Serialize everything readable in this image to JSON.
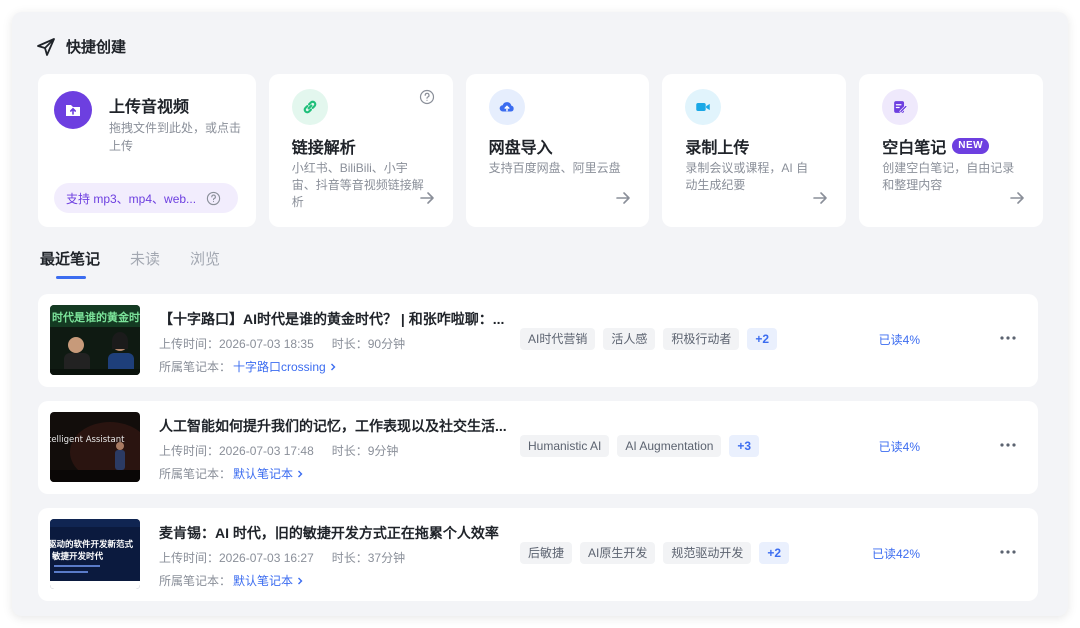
{
  "quick_create": {
    "title": "快捷创建",
    "upload": {
      "title": "上传音视频",
      "desc": "拖拽文件到此处，或点击上传",
      "formats": "支持 mp3、mp4、web..."
    },
    "cards": [
      {
        "title": "链接解析",
        "desc": "小红书、BiliBili、小宇宙、抖音等音视频链接解析",
        "icon": "link-icon",
        "color": "#1fbf7a",
        "bg": "#e3f7ee"
      },
      {
        "title": "网盘导入",
        "desc": "支持百度网盘、阿里云盘",
        "icon": "cloud-upload-icon",
        "color": "#3b6cf0",
        "bg": "#e6eefd"
      },
      {
        "title": "录制上传",
        "desc": "录制会议或课程，AI 自动生成纪要",
        "icon": "video-camera-icon",
        "color": "#1aa8e6",
        "bg": "#e1f4fc"
      },
      {
        "title": "空白笔记",
        "desc": "创建空白笔记，自由记录和整理内容",
        "icon": "edit-note-icon",
        "color": "#6d3fe0",
        "bg": "#efe9fc",
        "badge": "NEW"
      }
    ]
  },
  "tabs": [
    {
      "label": "最近笔记",
      "active": true
    },
    {
      "label": "未读",
      "active": false
    },
    {
      "label": "浏览",
      "active": false
    }
  ],
  "notes": [
    {
      "title": "【十字路口】AI时代是谁的黄金时代？ | 和张咋啦聊：...",
      "uploaded": "上传时间：2026-07-03 18:35",
      "duration": "时长：90分钟",
      "book_label": "所属笔记本：",
      "book": "十字路口crossing",
      "tags": [
        "AI时代营销",
        "活人感",
        "积极行动者"
      ],
      "more": "+2",
      "read": "已读4%"
    },
    {
      "title": "人工智能如何提升我们的记忆，工作表现以及社交生活...",
      "uploaded": "上传时间：2026-07-03 17:48",
      "duration": "时长：9分钟",
      "book_label": "所属笔记本：",
      "book": "默认笔记本",
      "tags": [
        "Humanistic AI",
        "AI Augmentation"
      ],
      "more": "+3",
      "read": "已读4%"
    },
    {
      "title": "麦肯锡：AI 时代，旧的敏捷开发方式正在拖累个人效率",
      "uploaded": "上传时间：2026-07-03 16:27",
      "duration": "时长：37分钟",
      "book_label": "所属笔记本：",
      "book": "默认笔记本",
      "tags": [
        "后敏捷",
        "AI原生开发",
        "规范驱动开发"
      ],
      "more": "+2",
      "read": "已读42%"
    }
  ],
  "thumbs": [
    {
      "text": "时代是谁的黄金时代"
    },
    {
      "text": "telligent Assistant"
    },
    {
      "text": "驱动的软件开发新范式",
      "text2": "敏捷开发时代"
    }
  ]
}
